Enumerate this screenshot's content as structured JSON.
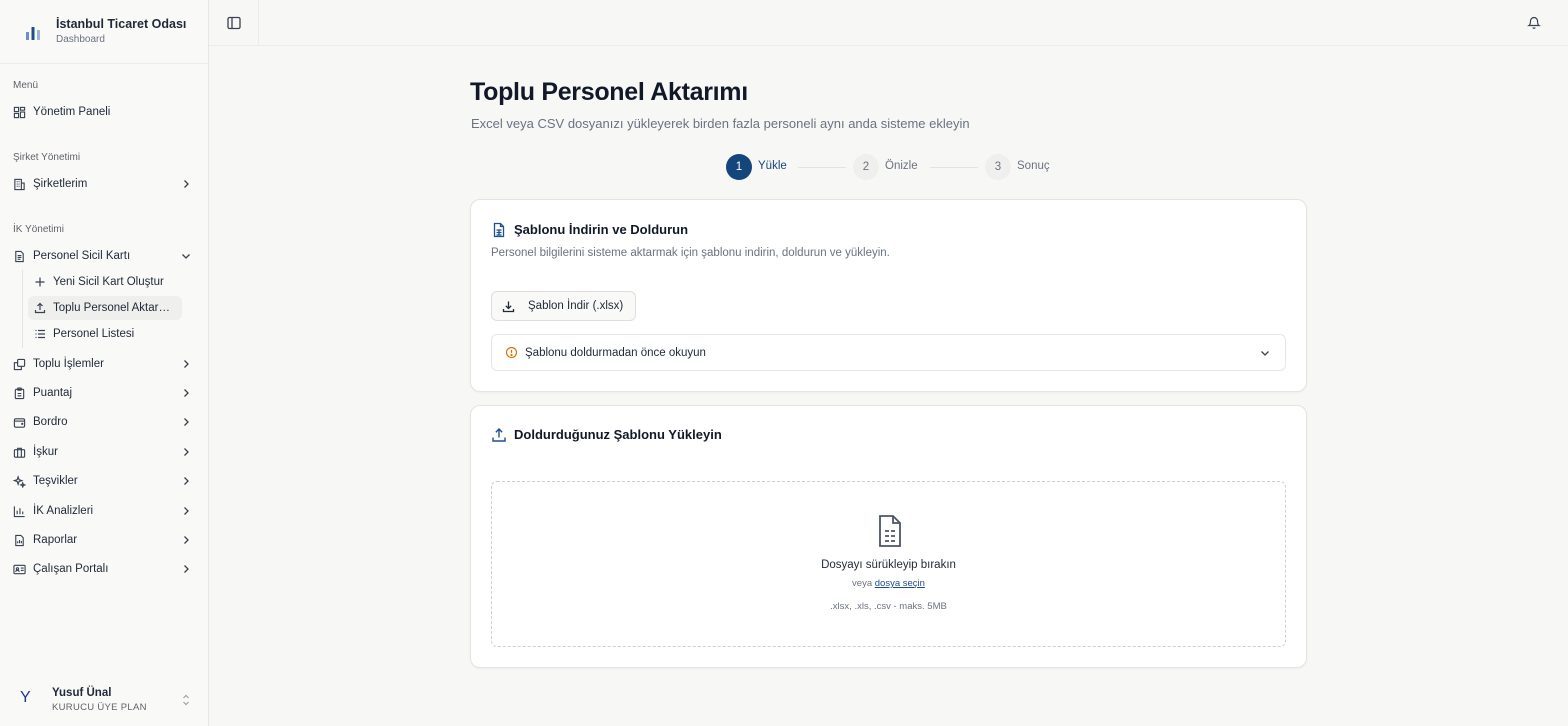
{
  "brand": {
    "title": "İstanbul Ticaret Odası",
    "subtitle": "Dashboard"
  },
  "sidebar": {
    "groups": {
      "menu": "Menü",
      "company": "Şirket Yönetimi",
      "hr": "İK Yönetimi"
    },
    "items": {
      "dashboard": "Yönetim Paneli",
      "companies": "Şirketlerim",
      "personnel_card": "Personel Sicil Kartı",
      "new_card": "Yeni Sicil Kart Oluştur",
      "bulk_transfer": "Toplu Personel Aktarımı",
      "personnel_list": "Personel Listesi",
      "bulk_ops": "Toplu İşlemler",
      "timesheet": "Puantaj",
      "payroll": "Bordro",
      "iskur": "İşkur",
      "incentives": "Teşvikler",
      "hr_analytics": "İK Analizleri",
      "reports": "Raporlar",
      "employee_portal": "Çalışan Portalı"
    }
  },
  "user": {
    "avatar": "Y",
    "name": "Yusuf Ünal",
    "plan": "KURUCU ÜYE PLAN"
  },
  "page": {
    "title": "Toplu Personel Aktarımı",
    "subtitle": "Excel veya CSV dosyanızı yükleyerek birden fazla personeli aynı anda sisteme ekleyin"
  },
  "stepper": [
    {
      "num": "1",
      "label": "Yükle",
      "active": true
    },
    {
      "num": "2",
      "label": "Önizle",
      "active": false
    },
    {
      "num": "3",
      "label": "Sonuç",
      "active": false
    }
  ],
  "template_card": {
    "title": "Şablonu İndirin ve Doldurun",
    "description": "Personel bilgilerini sisteme aktarmak için şablonu indirin, doldurun ve yükleyin.",
    "download_label": "Şablon İndir (.xlsx)",
    "accordion_label": "Şablonu doldurmadan önce okuyun"
  },
  "upload_card": {
    "title": "Doldurduğunuz Şablonu Yükleyin",
    "drop_title": "Dosyayı sürükleyip bırakın",
    "or_text": "veya",
    "choose_link": "dosya seçin",
    "hint": ".xlsx, .xls, .csv - maks. 5MB"
  },
  "colors": {
    "accent": "#14467c",
    "warning": "#d97706"
  },
  "icons": {
    "brand": "bar-chart-icon",
    "sidebar_toggle": "sidebar-toggle-icon",
    "notifications": "bell-icon",
    "dashboard": "grid-icon",
    "companies": "building-icon",
    "personnel_card": "document-icon",
    "new_card": "plus-icon",
    "bulk_transfer": "upload-icon",
    "personnel_list": "list-icon",
    "bulk_ops": "copy-icon",
    "timesheet": "clipboard-icon",
    "payroll": "wallet-icon",
    "iskur": "briefcase-icon",
    "incentives": "sparkles-icon",
    "hr_analytics": "bar-chart-icon",
    "reports": "report-icon",
    "employee_portal": "id-card-icon",
    "download": "download-icon",
    "info": "alert-circle-icon",
    "file_spreadsheet": "file-spreadsheet-icon",
    "upload": "upload-icon"
  }
}
